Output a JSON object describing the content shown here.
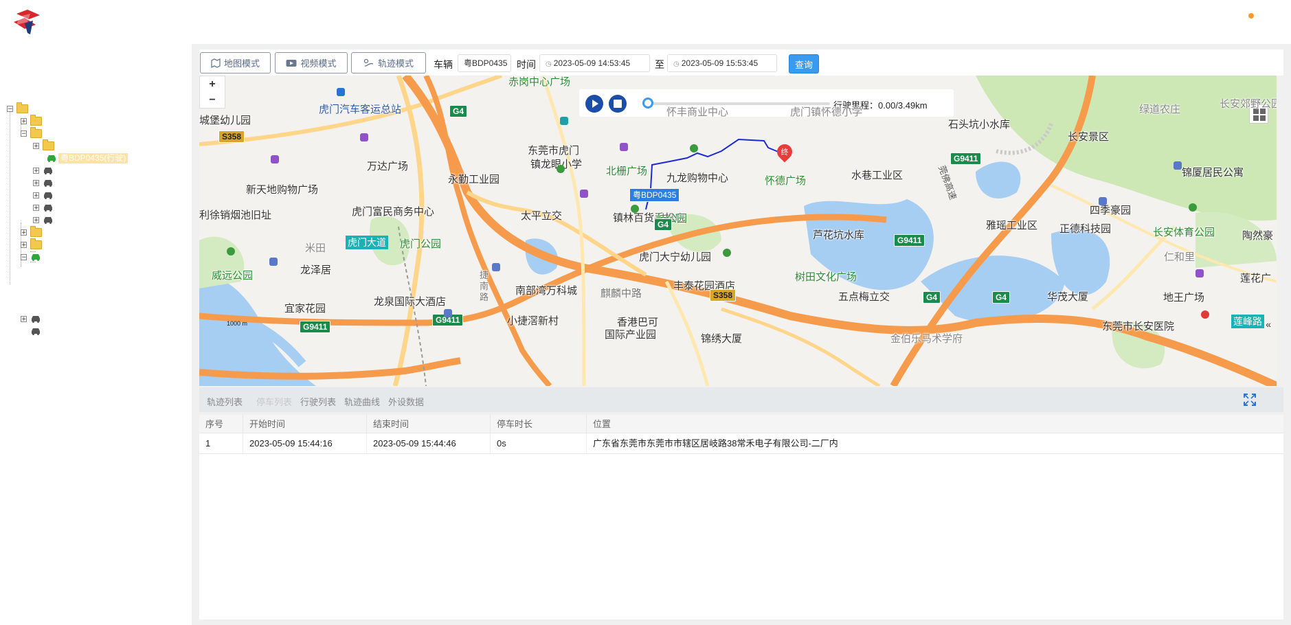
{
  "colors": {
    "brand_red": "#d8262e",
    "accent_blue": "#3a9af0",
    "route_blue": "#1d29d6",
    "status_dot": "#ff9a2e"
  },
  "tree": {
    "selected_vehicle": "粤BDP0435(行驶)"
  },
  "toolbar": {
    "map_mode": "地图模式",
    "video_mode": "视频模式",
    "track_mode": "轨迹模式",
    "vehicle_label": "车辆",
    "vehicle_value": "粤BDP0435",
    "time_label": "时间",
    "start_time": "2023-05-09 14:53:45",
    "to_label": "至",
    "end_time": "2023-05-09 15:53:45",
    "query_label": "查询"
  },
  "map": {
    "zoom_in": "+",
    "zoom_out": "−",
    "mileage_label": "行驶里程：",
    "mileage_value": "0.00/3.49km",
    "vehicle_tag": "粤BDP0435",
    "end_marker": "终",
    "scale": "1000 m",
    "collapse": "«",
    "labels": [
      "虎门汽车客运总站",
      "赤岗中心广场",
      "东莞市虎门",
      "镇龙眼小学",
      "城堡幼儿园",
      "万达广场",
      "新天地购物广场",
      "虎门富民商务中心",
      "永勤工业园",
      "北栅广场",
      "九龙购物中心",
      "怀德广场",
      "水巷工业区",
      "石头坑小水库",
      "长安景区",
      "绿道农庄",
      "长安郊野公园",
      "锦厦居民公寓",
      "四季豪园",
      "雅瑶工业区",
      "正德科技园",
      "长安体育公园",
      "陶然豪",
      "仁和里",
      "莲花广",
      "地王广场",
      "华茂大厦",
      "东莞市长安医院",
      "莲峰路",
      "太平立交",
      "镇林百货手机店",
      "岐公园",
      "芦花坑水库",
      "树田文化广场",
      "五点梅立交",
      "丰泰花园酒店",
      "虎门大宁幼儿园",
      "南部湾万科城",
      "麒麟中路",
      "小捷滘新村",
      "香港巴可",
      "国际产业园",
      "锦绣大厦",
      "金伯乐马术学府",
      "龙泉国际大酒店",
      "宜家花园",
      "龙泽居",
      "威远公园",
      "米田",
      "虎门公园",
      "虎门大道",
      "捷南路",
      "利徐销烟池旧址",
      "怀丰商业中心",
      "虎门镇怀德小学"
    ],
    "shields": [
      "G4",
      "G4",
      "G4",
      "G4",
      "G9411",
      "G9411",
      "G9411",
      "G9411",
      "S358",
      "S358",
      "莞佛高速"
    ]
  },
  "bottom": {
    "tabs": [
      "轨迹列表",
      "停车列表",
      "行驶列表",
      "轨迹曲线",
      "外设数据"
    ],
    "columns": [
      "序号",
      "开始时间",
      "结束时间",
      "停车时长",
      "位置"
    ],
    "rows": [
      [
        "1",
        "2023-05-09 15:44:16",
        "2023-05-09 15:44:46",
        "0s",
        "广东省东莞市东莞市市辖区居岐路38常禾电子有限公司-二厂内"
      ]
    ]
  }
}
